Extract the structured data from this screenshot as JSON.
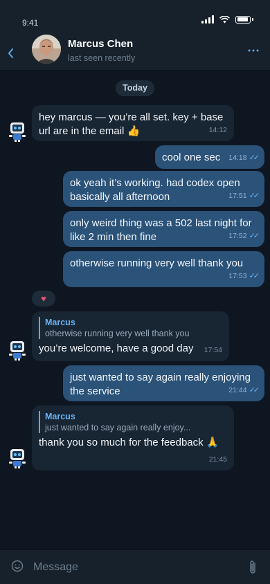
{
  "status_bar": {
    "time": "9:41"
  },
  "header": {
    "back_icon": "chevron-left-icon",
    "contact_name": "Marcus Chen",
    "contact_status": "last seen recently",
    "more_icon": "more-dots-icon"
  },
  "date_chip": "Today",
  "messages": [
    {
      "dir": "in",
      "text": "hey marcus — you’re all set. key + base url are in the email 👍",
      "time": "14:12"
    },
    {
      "dir": "out",
      "text": "cool one sec",
      "time": "14:18"
    },
    {
      "dir": "out",
      "text": "ok yeah it’s working. had codex open basically all afternoon",
      "time": "17:51"
    },
    {
      "dir": "out",
      "text": "only weird thing was a 502 last night for like 2 min then fine",
      "time": "17:52"
    },
    {
      "dir": "out",
      "text": "otherwise running very well thank you",
      "time": "17:53"
    },
    {
      "dir": "in",
      "reply_author": "Marcus",
      "reply_text": "otherwise running very well thank you",
      "text": "you’re welcome, have a good day",
      "time": "17:54"
    },
    {
      "dir": "out",
      "text": "just wanted to say again really enjoying the service",
      "time": "21:44"
    },
    {
      "dir": "in",
      "reply_author": "Marcus",
      "reply_text": "just wanted to say again really enjoy...",
      "text": "thank you so much for the feedback 🙏",
      "time": "21:45"
    }
  ],
  "reaction": "♥",
  "composer": {
    "placeholder": "Message",
    "emoji_icon": "smiley-icon",
    "attach_icon": "paperclip-icon"
  },
  "colors": {
    "background": "#0e1621",
    "incoming": "#182533",
    "outgoing": "#2b5278",
    "accent": "#5fa8e8"
  }
}
